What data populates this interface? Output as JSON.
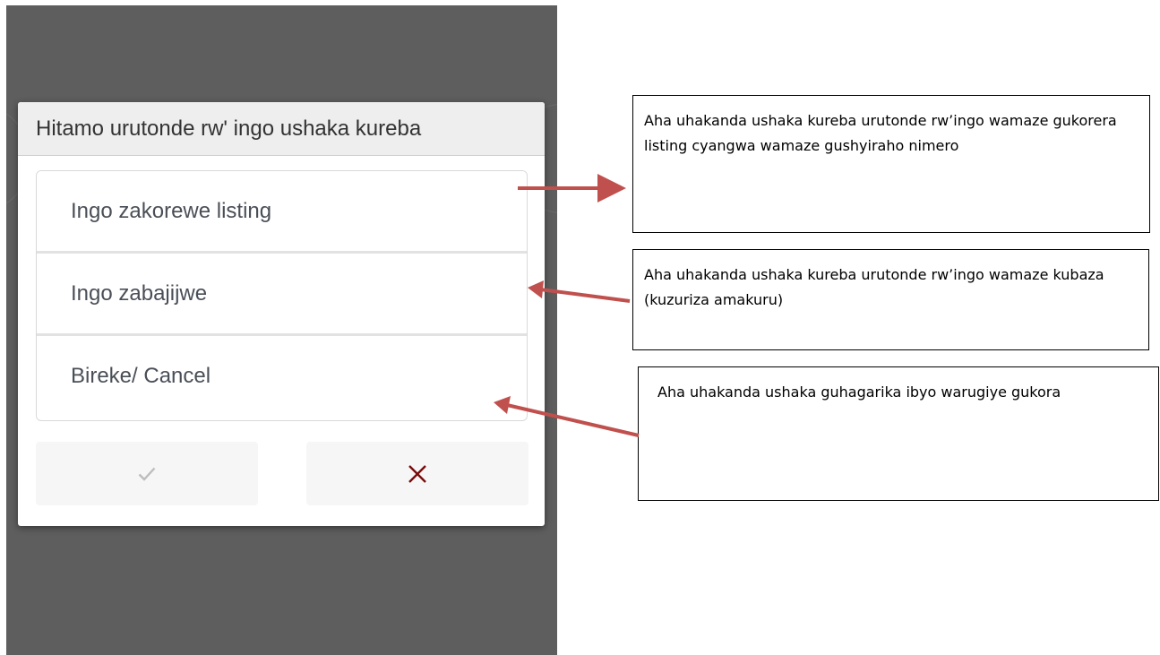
{
  "dialog": {
    "title": "Hitamo urutonde rw' ingo ushaka kureba",
    "options": [
      {
        "label": "Ingo zakorewe listing"
      },
      {
        "label": "Ingo zabajijwe"
      },
      {
        "label": "Bireke/ Cancel"
      }
    ],
    "confirm_icon": "check-icon",
    "cancel_icon": "close-icon"
  },
  "annotations": [
    {
      "text": "Aha uhakanda ushaka kureba urutonde rw’ingo wamaze gukorera listing cyangwa wamaze gushyiraho nimero"
    },
    {
      "text": "Aha uhakanda ushaka kureba urutonde rw’ingo wamaze kubaza (kuzuriza amakuru)"
    },
    {
      "text": "Aha uhakanda ushaka guhagarika ibyo warugiye gukora"
    }
  ],
  "colors": {
    "overlay": "#5e5e5e",
    "arrow": "#c0504d",
    "cancel_x": "#7a0b0b",
    "check": "#bdbdbd"
  }
}
